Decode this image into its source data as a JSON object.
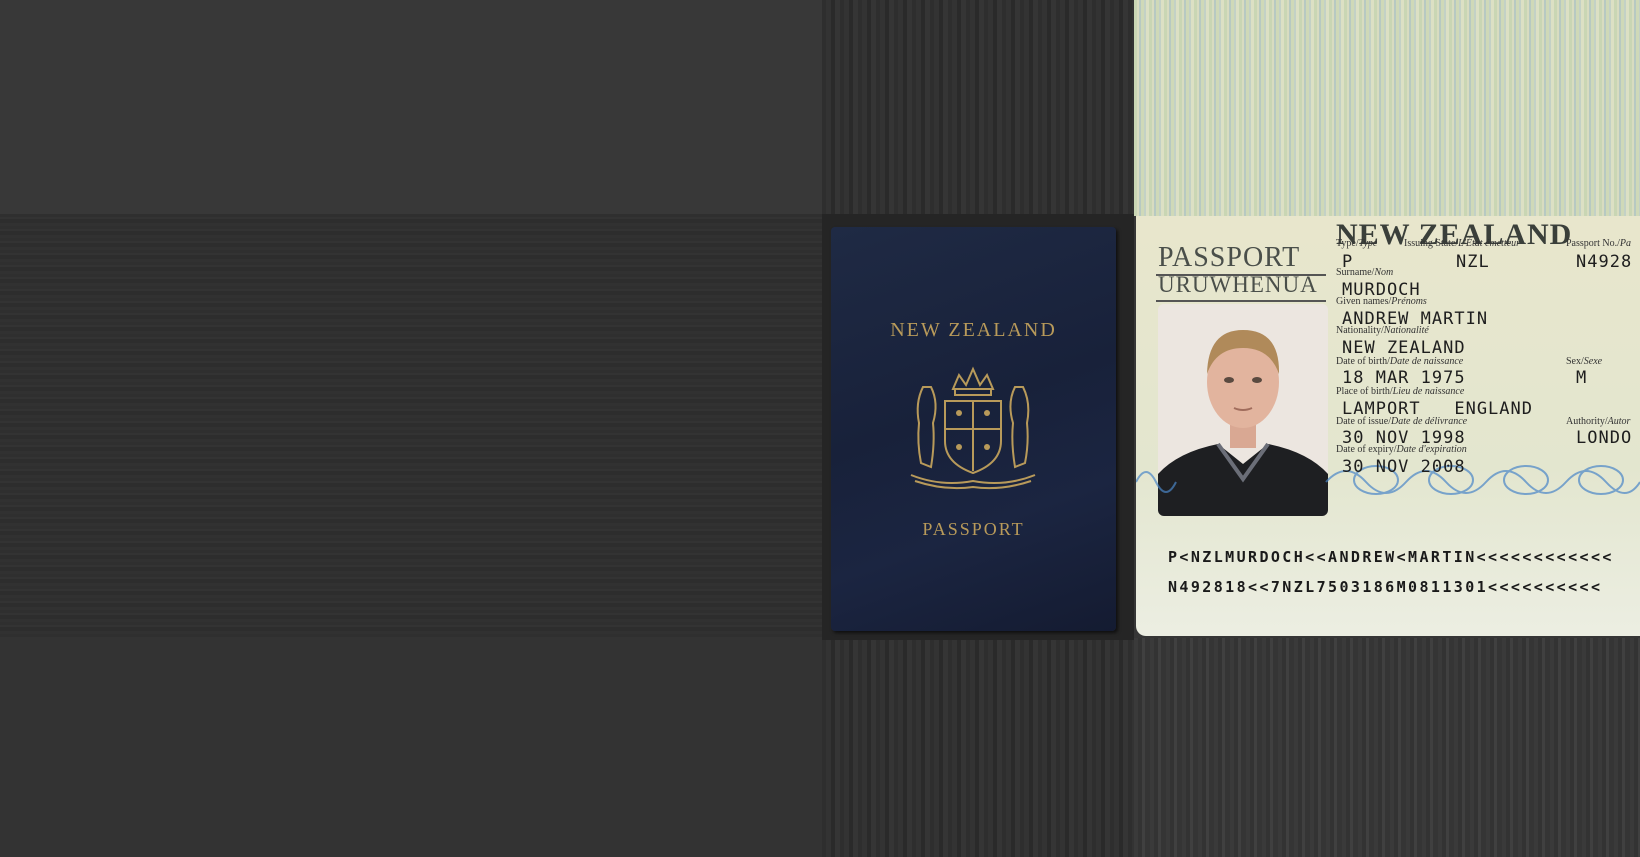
{
  "cover": {
    "title": "NEW ZEALAND",
    "subtitle": "PASSPORT",
    "emblem": "coat-of-arms-icon"
  },
  "datapage": {
    "header": "NEW ZEALAND",
    "passport_word": "PASSPORT",
    "maori_word": "URUWHENUA",
    "labels": {
      "type": "Type/",
      "type_fr": "Type",
      "issuing_state": "Issuing State/",
      "issuing_state_fr": "L'État émetteur",
      "passport_no": "Passport No./",
      "passport_no_fr": "Pa",
      "surname": "Surname/",
      "surname_fr": "Nom",
      "given_names": "Given names/",
      "given_names_fr": "Prénoms",
      "nationality": "Nationality/",
      "nationality_fr": "Nationalité",
      "dob": "Date of birth/",
      "dob_fr": "Date de naissance",
      "sex": "Sex/",
      "sex_fr": "Sexe",
      "pob": "Place of birth/",
      "pob_fr": "Lieu de naissance",
      "doi": "Date of issue/",
      "doi_fr": "Date de délivrance",
      "authority": "Authority/",
      "authority_fr": "Autor",
      "doe": "Date of expiry/",
      "doe_fr": "Date d'expiration"
    },
    "values": {
      "type": "P",
      "issuing_state": "NZL",
      "passport_no": "N4928",
      "surname": "MURDOCH",
      "given_names": "ANDREW MARTIN",
      "nationality": "NEW ZEALAND",
      "dob": "18 MAR 1975",
      "sex": "M",
      "pob": "LAMPORT   ENGLAND",
      "doi": "30 NOV 1998",
      "authority": "LONDO",
      "doe": "30 NOV 2008"
    },
    "mrz_line1": "P<NZLMURDOCH<<ANDREW<MARTIN<<<<<<<<<<<<",
    "mrz_line2": "N492818<<7NZL7503186M0811301<<<<<<<<<<"
  },
  "colors": {
    "cover": "#1b2541",
    "gold": "#b89a5a",
    "page": "#e8e6cc",
    "pattern": "#4a86c8"
  }
}
